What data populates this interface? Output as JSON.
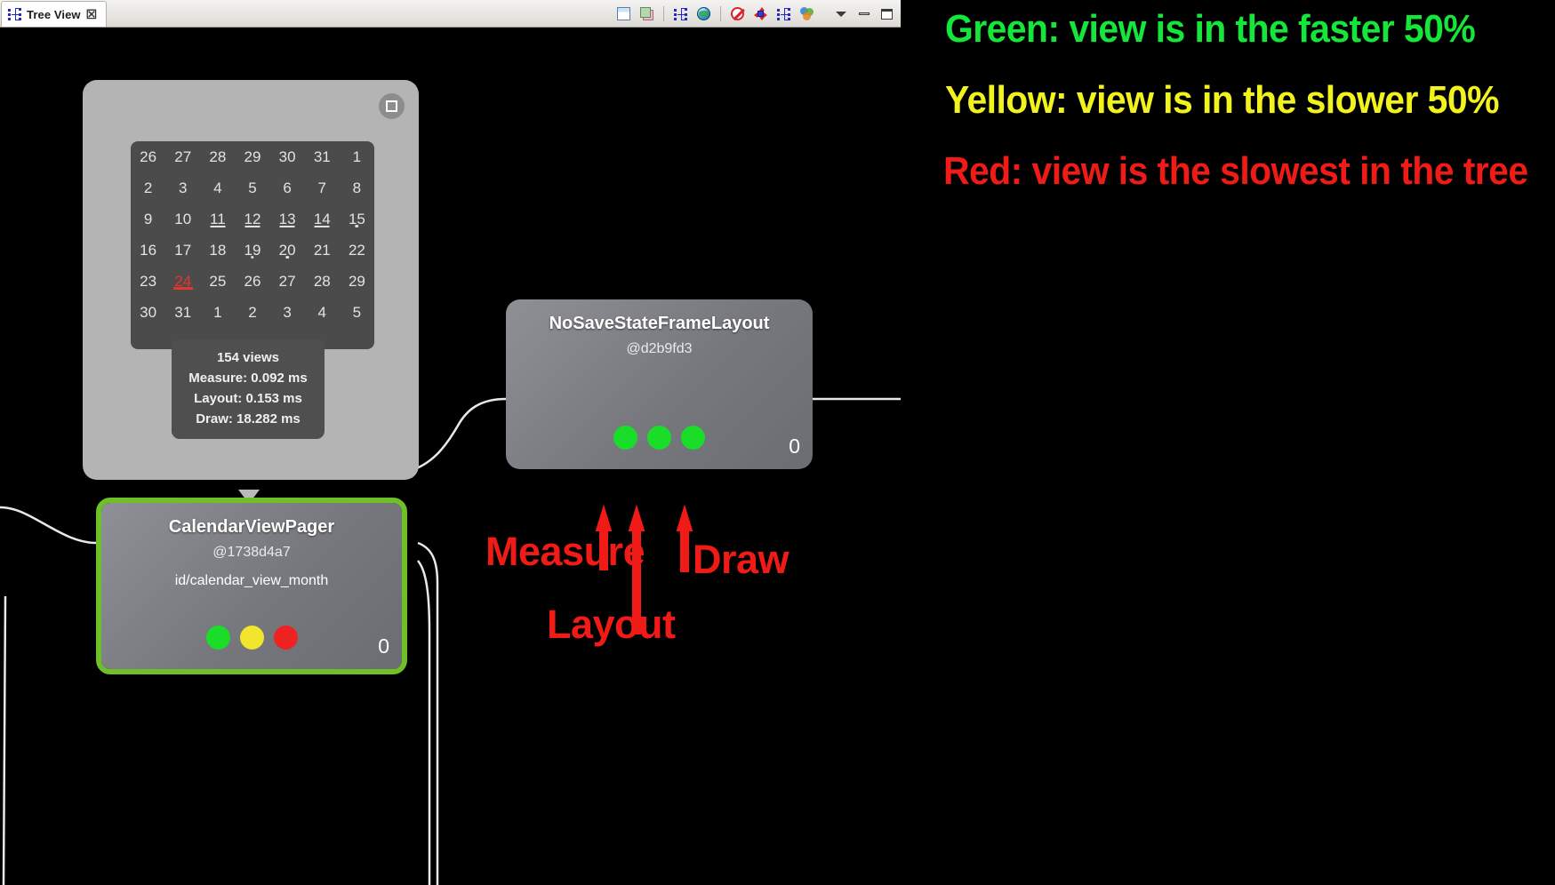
{
  "window": {
    "tab": {
      "label": "Tree View",
      "icon": "tree-icon",
      "close": "☒"
    },
    "toolbar": [
      {
        "name": "save-as-png-button",
        "icon": "page-icon"
      },
      {
        "name": "save-layers-button",
        "icon": "stacked-layers-icon"
      },
      {
        "name": "load-view-hierarchy-button",
        "icon": "tree-icon"
      },
      {
        "name": "inspect-screenshot-button",
        "icon": "globe-icon"
      },
      {
        "name": "stop-process-button",
        "icon": "stop-icon"
      },
      {
        "name": "invalidate-layout-button",
        "icon": "crosshair-icon"
      },
      {
        "name": "request-layout-button",
        "icon": "tree-icon"
      },
      {
        "name": "display-options-button",
        "icon": "venn-icon"
      },
      {
        "name": "view-menu-button",
        "icon": "chevron-down-icon"
      },
      {
        "name": "minimize-button",
        "icon": "minimize-icon"
      },
      {
        "name": "maximize-button",
        "icon": "maximize-icon"
      }
    ]
  },
  "preview": {
    "expand_button_icon": "square-in-circle-icon",
    "calendar": {
      "rows": [
        [
          {
            "d": "26"
          },
          {
            "d": "27"
          },
          {
            "d": "28"
          },
          {
            "d": "29"
          },
          {
            "d": "30"
          },
          {
            "d": "31"
          },
          {
            "d": "1"
          }
        ],
        [
          {
            "d": "2"
          },
          {
            "d": "3"
          },
          {
            "d": "4"
          },
          {
            "d": "5"
          },
          {
            "d": "6"
          },
          {
            "d": "7"
          },
          {
            "d": "8"
          }
        ],
        [
          {
            "d": "9"
          },
          {
            "d": "10"
          },
          {
            "d": "11",
            "mark": "bar"
          },
          {
            "d": "12",
            "mark": "bar"
          },
          {
            "d": "13",
            "mark": "bar"
          },
          {
            "d": "14",
            "mark": "bar"
          },
          {
            "d": "15",
            "mark": "dot"
          }
        ],
        [
          {
            "d": "16"
          },
          {
            "d": "17"
          },
          {
            "d": "18"
          },
          {
            "d": "19",
            "mark": "dot"
          },
          {
            "d": "20",
            "mark": "dot"
          },
          {
            "d": "21"
          },
          {
            "d": "22"
          }
        ],
        [
          {
            "d": "23"
          },
          {
            "d": "24",
            "today": true,
            "mark": "bar-red"
          },
          {
            "d": "25"
          },
          {
            "d": "26"
          },
          {
            "d": "27"
          },
          {
            "d": "28"
          },
          {
            "d": "29"
          }
        ],
        [
          {
            "d": "30"
          },
          {
            "d": "31"
          },
          {
            "d": "1"
          },
          {
            "d": "2"
          },
          {
            "d": "3"
          },
          {
            "d": "4"
          },
          {
            "d": "5"
          }
        ]
      ]
    },
    "tooltip": {
      "views": "154 views",
      "measure": "Measure: 0.092 ms",
      "layout": "Layout: 0.153 ms",
      "draw": "Draw: 18.282 ms"
    }
  },
  "nodes": [
    {
      "name": "NoSaveStateFrameLayout",
      "hash": "@d2b9fd3",
      "id": "",
      "count": "0",
      "selected": false,
      "dots": [
        "#19dd28",
        "#19dd28",
        "#19dd28"
      ]
    },
    {
      "name": "CalendarViewPager",
      "hash": "@1738d4a7",
      "id": "id/calendar_view_month",
      "count": "0",
      "selected": true,
      "dots": [
        "#19dd28",
        "#f2e62c",
        "#ef2222"
      ]
    }
  ],
  "annotations": {
    "arrow_color": "#f01b16",
    "labels": [
      {
        "text": "Measure"
      },
      {
        "text": "Layout"
      },
      {
        "text": "Draw"
      }
    ]
  },
  "legend": {
    "lines": [
      {
        "text": "Green: view is in the faster 50%",
        "color": "#15e63a"
      },
      {
        "text": "Yellow: view is in the slower 50%",
        "color": "#f2f21c"
      },
      {
        "text": "Red: view is the slowest in the tree",
        "color": "#f01b16"
      }
    ]
  },
  "colors": {
    "green": "#19dd28",
    "yellow": "#f2e62c",
    "red": "#ef2222",
    "selection": "#6fc028",
    "canvas_bg": "#000000"
  }
}
